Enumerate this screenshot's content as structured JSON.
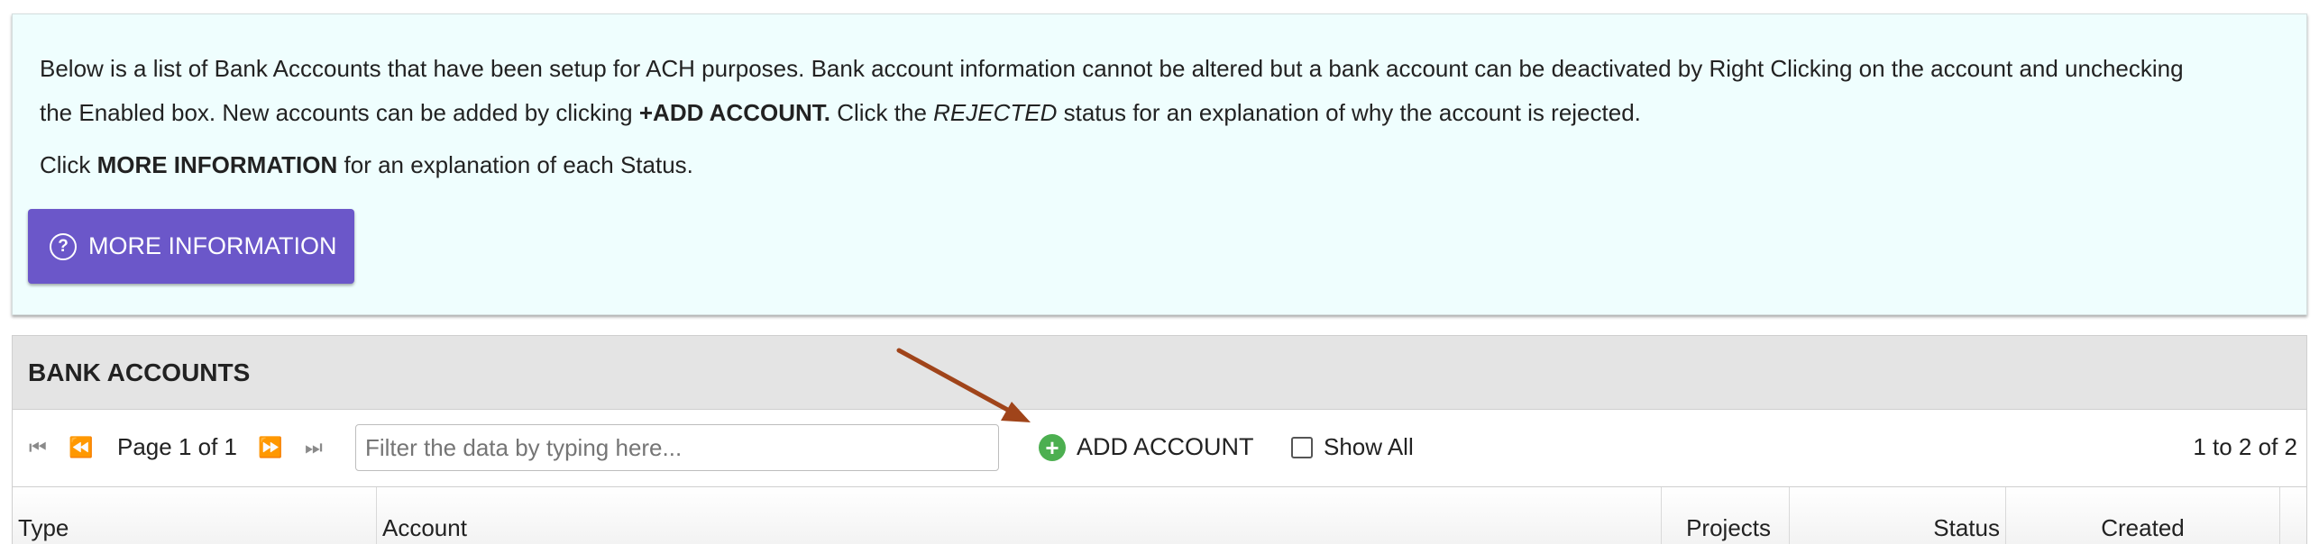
{
  "info": {
    "line1": "Below is a list of Bank Acccounts that have been setup for ACH purposes. Bank account information cannot be altered but a bank account can be deactivated by Right Clicking on the account and unchecking",
    "line2_a": "the Enabled box. New accounts can be added by clicking ",
    "line2_bold": "+ADD ACCOUNT.",
    "line2_b": " Click the ",
    "line2_italic": "REJECTED",
    "line2_c": " status for an explanation of why the account is rejected.",
    "line3_a": "Click ",
    "line3_bold": "MORE INFORMATION",
    "line3_b": " for an explanation of each Status.",
    "more_button_label": "MORE INFORMATION"
  },
  "grid": {
    "title": "BANK ACCOUNTS",
    "page_label": "Page 1 of 1",
    "filter_placeholder": "Filter the data by typing here...",
    "add_account_label": "ADD ACCOUNT",
    "show_all_label": "Show All",
    "show_all_checked": false,
    "count_label": "1 to 2 of 2",
    "columns": [
      "Type",
      "Account",
      "Projects",
      "Status",
      "Created"
    ]
  },
  "icons": {
    "first_page": "first-page-icon",
    "prev_page": "previous-page-icon",
    "next_page": "next-page-icon",
    "last_page": "last-page-icon",
    "help": "question-circle-icon",
    "add": "plus-circle-icon",
    "annotation": "arrow-annotation"
  },
  "colors": {
    "info_background": "#effefe",
    "primary_button": "#6b57c9",
    "add_icon": "#4caf50",
    "header_background": "#e4e4e4",
    "annotation_arrow": "#a0441a"
  }
}
